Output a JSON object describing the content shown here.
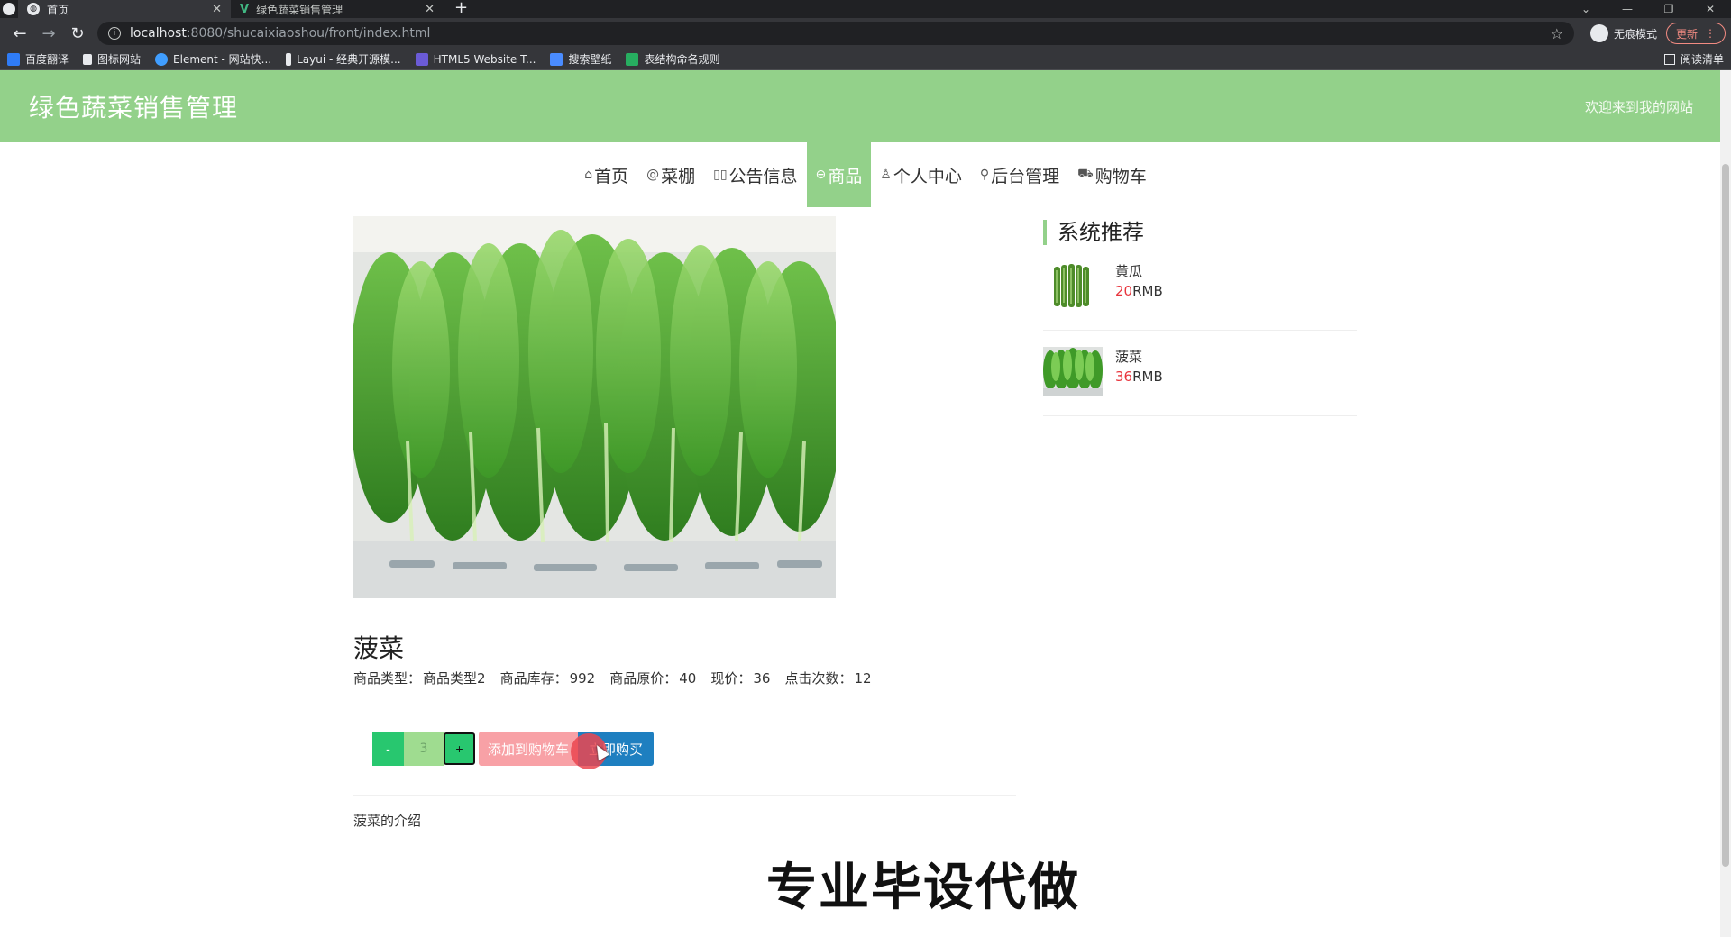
{
  "browser": {
    "tabs": [
      {
        "title": "首页",
        "active": true
      },
      {
        "title": "绿色蔬菜销售管理",
        "active": false
      }
    ],
    "new_tab": "+",
    "url_host": "localhost",
    "url_path": ":8080/shucaixiaoshou/front/index.html",
    "incognito_label": "无痕模式",
    "update_label": "更新",
    "bookmarks": [
      {
        "label": "百度翻译",
        "color": "#2f7cf6"
      },
      {
        "label": "图标网站",
        "color": "#ffffff"
      },
      {
        "label": "Element - 网站快...",
        "color": "#409eff"
      },
      {
        "label": "Layui - 经典开源模...",
        "color": "#ffffff"
      },
      {
        "label": "HTML5 Website T...",
        "color": "#6b5bd6"
      },
      {
        "label": "搜索壁纸",
        "color": "#4a8cff"
      },
      {
        "label": "表结构命名规则",
        "color": "#27ae60"
      }
    ],
    "reading_list": "阅读清单"
  },
  "header": {
    "title": "绿色蔬菜销售管理",
    "welcome": "欢迎来到我的网站"
  },
  "nav": {
    "items": [
      {
        "label": "首页",
        "icon": "⌂"
      },
      {
        "label": "菜棚",
        "icon": "@"
      },
      {
        "label": "公告信息",
        "icon": "▯▯"
      },
      {
        "label": "商品",
        "icon": "⊖"
      },
      {
        "label": "个人中心",
        "icon": "♙"
      },
      {
        "label": "后台管理",
        "icon": "⚲"
      },
      {
        "label": "购物车",
        "icon": "⛟"
      }
    ],
    "active_index": 3
  },
  "product": {
    "name": "菠菜",
    "meta": [
      {
        "key": "商品类型：",
        "value": "商品类型2"
      },
      {
        "key": "商品库存：",
        "value": "992"
      },
      {
        "key": "商品原价：",
        "value": "40"
      },
      {
        "key": "现价：",
        "value": "36"
      },
      {
        "key": "点击次数：",
        "value": "12"
      }
    ],
    "quantity": "3",
    "minus_label": "-",
    "plus_label": "+",
    "add_cart_label": "添加到购物车",
    "buy_now_label": "立即购买",
    "description": "菠菜的介绍"
  },
  "sidebar": {
    "title": "系统推荐",
    "items": [
      {
        "name": "黄瓜",
        "price": "20",
        "unit": "RMB"
      },
      {
        "name": "菠菜",
        "price": "36",
        "unit": "RMB"
      }
    ]
  },
  "overlay": {
    "watermark": "专业毕设代做"
  },
  "colors": {
    "brand_green": "#93d18a",
    "price_red": "#e8353d",
    "buy_blue": "#1e7fc0",
    "cart_pink": "#f8a1a6"
  }
}
